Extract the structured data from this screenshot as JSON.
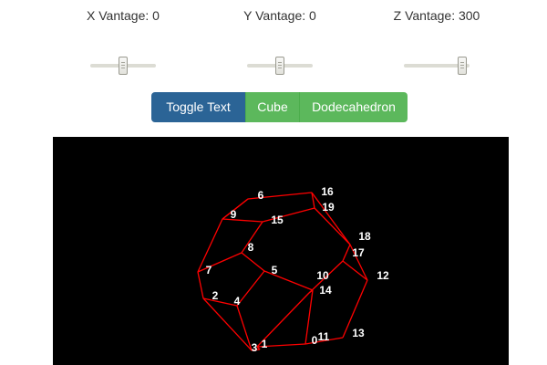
{
  "sliders": [
    {
      "label": "X Vantage: 0",
      "value": 0,
      "range": [
        -300,
        300
      ]
    },
    {
      "label": "Y Vantage: 0",
      "value": 0,
      "range": [
        -300,
        300
      ]
    },
    {
      "label": "Z Vantage: 300",
      "value": 300,
      "range": [
        -300,
        300
      ]
    }
  ],
  "buttons": {
    "toggle_text": "Toggle Text",
    "cube": "Cube",
    "dodecahedron": "Dodecahedron"
  },
  "colors": {
    "edge": "#ff0000",
    "label": "#ffffff",
    "background": "#000000",
    "primary": "#2b6496",
    "success": "#5cb85c"
  },
  "vertex_labels": [
    "0",
    "1",
    "2",
    "3",
    "4",
    "5",
    "6",
    "7",
    "8",
    "9",
    "10",
    "11",
    "12",
    "13",
    "14",
    "15",
    "16",
    "17",
    "18",
    "19"
  ]
}
